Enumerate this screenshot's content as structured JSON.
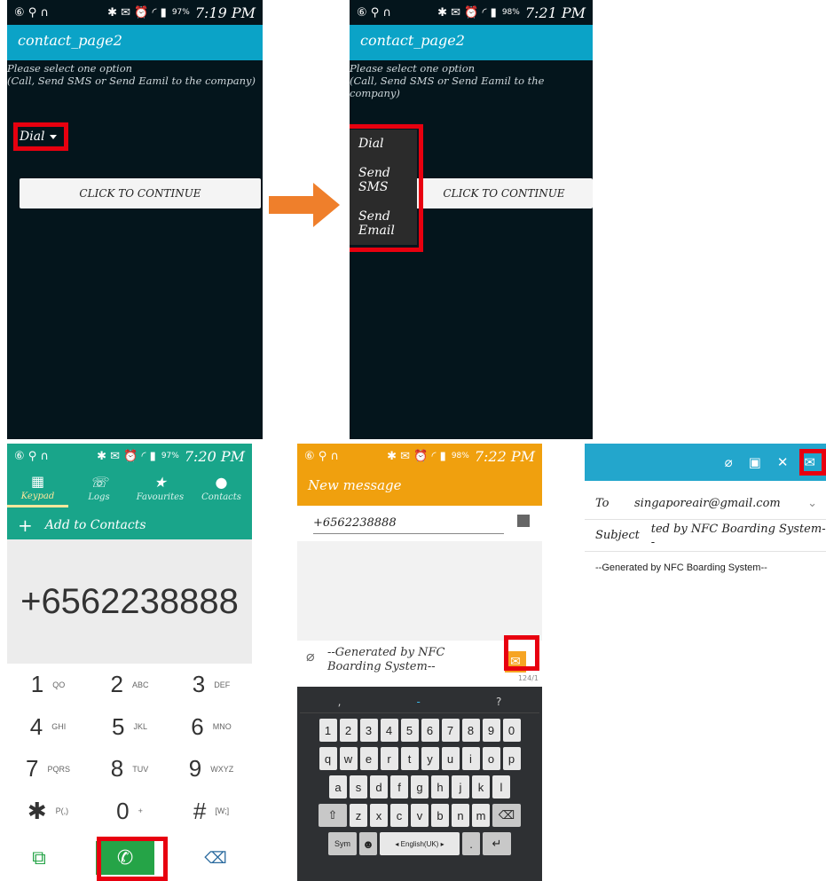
{
  "status": {
    "time1": "7:19 PM",
    "time2": "7:21 PM",
    "time3": "7:20 PM",
    "time4": "7:22 PM",
    "battery1": "97%",
    "battery2": "98%",
    "battery3": "97%",
    "battery4": "98%"
  },
  "screen1": {
    "app_title": "contact_page2",
    "prompt_line1": "Please select one option",
    "prompt_line2": "(Call, Send SMS or Send Eamil to the company)",
    "spinner_value": "Dial",
    "continue_label": "CLICK TO CONTINUE"
  },
  "screen2": {
    "app_title": "contact_page2",
    "prompt_line1": "Please select one option",
    "prompt_line2": "(Call, Send SMS or Send Eamil to the company)",
    "options": [
      "Dial",
      "Send SMS",
      "Send Email"
    ],
    "continue_label": "CLICK TO CONTINUE"
  },
  "dialer": {
    "tabs": [
      "Keypad",
      "Logs",
      "Favourites",
      "Contacts"
    ],
    "add_contacts": "Add to Contacts",
    "number": "+6562238888",
    "keys": [
      {
        "digit": "1",
        "letters": "QO"
      },
      {
        "digit": "2",
        "letters": "ABC"
      },
      {
        "digit": "3",
        "letters": "DEF"
      },
      {
        "digit": "4",
        "letters": "GHI"
      },
      {
        "digit": "5",
        "letters": "JKL"
      },
      {
        "digit": "6",
        "letters": "MNO"
      },
      {
        "digit": "7",
        "letters": "PQRS"
      },
      {
        "digit": "8",
        "letters": "TUV"
      },
      {
        "digit": "9",
        "letters": "WXYZ"
      },
      {
        "digit": "✱",
        "letters": "P(,)"
      },
      {
        "digit": "0",
        "letters": "+"
      },
      {
        "digit": "#",
        "letters": "[W;]"
      }
    ]
  },
  "sms": {
    "title": "New message",
    "recipient": "+6562238888",
    "body_line1": "--Generated by NFC",
    "body_line2": "Boarding System--",
    "counter": "124/1",
    "suggestions": [
      ",",
      "-",
      "?"
    ],
    "row_numbers": [
      "1",
      "2",
      "3",
      "4",
      "5",
      "6",
      "7",
      "8",
      "9",
      "0"
    ],
    "row_q": [
      "q",
      "w",
      "e",
      "r",
      "t",
      "y",
      "u",
      "i",
      "o",
      "p"
    ],
    "row_a": [
      "a",
      "s",
      "d",
      "f",
      "g",
      "h",
      "j",
      "k",
      "l"
    ],
    "row_z": [
      "z",
      "x",
      "c",
      "v",
      "b",
      "n",
      "m"
    ],
    "sym_label": "Sym",
    "space_label": "◂ English(UK) ▸"
  },
  "email": {
    "to_label": "To",
    "to_value": "singaporeair@gmail.com",
    "subject_label": "Subject",
    "subject_value": "ted by NFC Boarding System--",
    "body": "--Generated by NFC Boarding System--"
  }
}
